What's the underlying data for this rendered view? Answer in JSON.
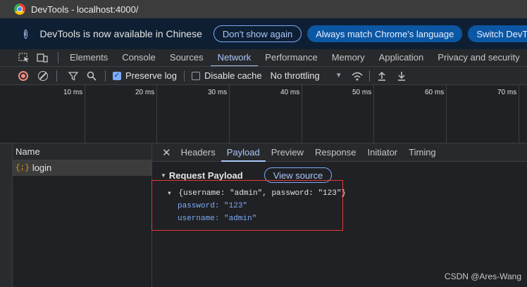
{
  "window": {
    "title": "DevTools - localhost:4000/"
  },
  "infobar": {
    "message": "DevTools is now available in Chinese",
    "dont_show": "Don't show again",
    "match_language": "Always match Chrome's language",
    "switch": "Switch DevTo"
  },
  "tabs": [
    "Elements",
    "Console",
    "Sources",
    "Network",
    "Performance",
    "Memory",
    "Application",
    "Privacy and security"
  ],
  "active_tab": "Network",
  "toolbar": {
    "preserve_log": "Preserve log",
    "disable_cache": "Disable cache",
    "throttling": "No throttling"
  },
  "timeline_ticks": [
    "10 ms",
    "20 ms",
    "30 ms",
    "40 ms",
    "50 ms",
    "60 ms",
    "70 ms"
  ],
  "requests": {
    "header": "Name",
    "items": [
      {
        "name": "login"
      }
    ]
  },
  "detail_tabs": [
    "Headers",
    "Payload",
    "Preview",
    "Response",
    "Initiator",
    "Timing"
  ],
  "active_detail_tab": "Payload",
  "payload": {
    "title": "Request Payload",
    "view_source": "View source",
    "summary": "{username: \"admin\", password: \"123\"}",
    "fields": [
      {
        "key": "password",
        "value": "\"123\""
      },
      {
        "key": "username",
        "value": "\"admin\""
      }
    ]
  },
  "watermark": "CSDN @Ares-Wang",
  "colors": {
    "accent": "#a8c7fa",
    "record": "#f28b82",
    "highlight_box": "#e53935"
  }
}
